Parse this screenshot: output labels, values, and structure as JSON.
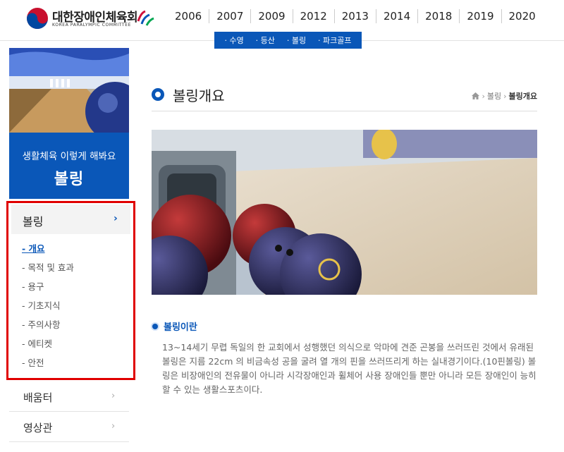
{
  "header": {
    "logo_text": "대한장애인체육회",
    "logo_sub": "KOREA PARALYMPIC COMMITTEE",
    "years": [
      "2006",
      "2007",
      "2009",
      "2012",
      "2013",
      "2014",
      "2018",
      "2019",
      "2020"
    ],
    "active_year": "2007"
  },
  "submenu": {
    "items": [
      "· 수영",
      "· 등산",
      "· 볼링",
      "· 파크골프"
    ]
  },
  "sidebar": {
    "banner_line1": "생활체육 이렇게 해봐요",
    "banner_line2": "볼링",
    "menu_head": "볼링",
    "menu_items": [
      "- 개요",
      "- 목적 및 효과",
      "- 용구",
      "- 기초지식",
      "- 주의사항",
      "- 에티켓",
      "- 안전"
    ],
    "other_items": [
      "배움터",
      "영상관"
    ]
  },
  "main": {
    "page_title": "볼링개요",
    "breadcrumb": [
      "볼링",
      "볼링개요"
    ],
    "section_title": "볼링이란",
    "section_body": "13~14세기 무렵 독일의 한 교회에서 성행했던 의식으로 악마에 견준 곤봉을 쓰러뜨린 것에서 유래된 볼링은 지름 22cm 의 비금속성 공을 굴려 열 개의 핀을 쓰러뜨리게 하는 실내경기이다.(10핀볼링) 볼링은 비장애인의 전유물이 아니라 시각장애인과 휠체어 사용 장애인들 뿐만 아니라 모든 장애인이 능히 할 수 있는 생활스포츠이다."
  },
  "colors": {
    "brand_blue": "#0a57b8",
    "highlight_red": "#e00000"
  }
}
